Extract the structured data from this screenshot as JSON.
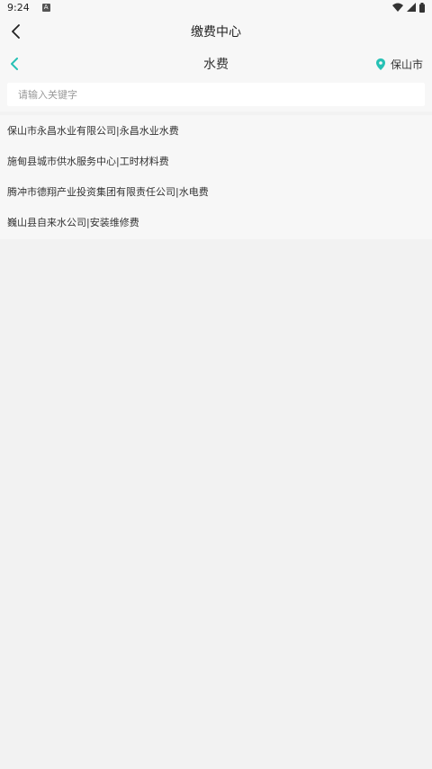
{
  "status_bar": {
    "time": "9:24",
    "notif_icon_label": "A"
  },
  "header": {
    "title": "缴费中心"
  },
  "sub_header": {
    "title": "水费",
    "location": "保山市"
  },
  "search": {
    "placeholder": "请输入关键字",
    "value": ""
  },
  "list": {
    "items": [
      {
        "label": "保山市永昌水业有限公司|永昌水业水费"
      },
      {
        "label": "施甸县城市供水服务中心|工时材料费"
      },
      {
        "label": "腾冲市德翔产业投资集团有限责任公司|水电费"
      },
      {
        "label": "巍山县自来水公司|安装维修费"
      }
    ]
  },
  "colors": {
    "accent": "#27c1b5",
    "background": "#f2f2f2",
    "panel": "#f7f7f7"
  }
}
